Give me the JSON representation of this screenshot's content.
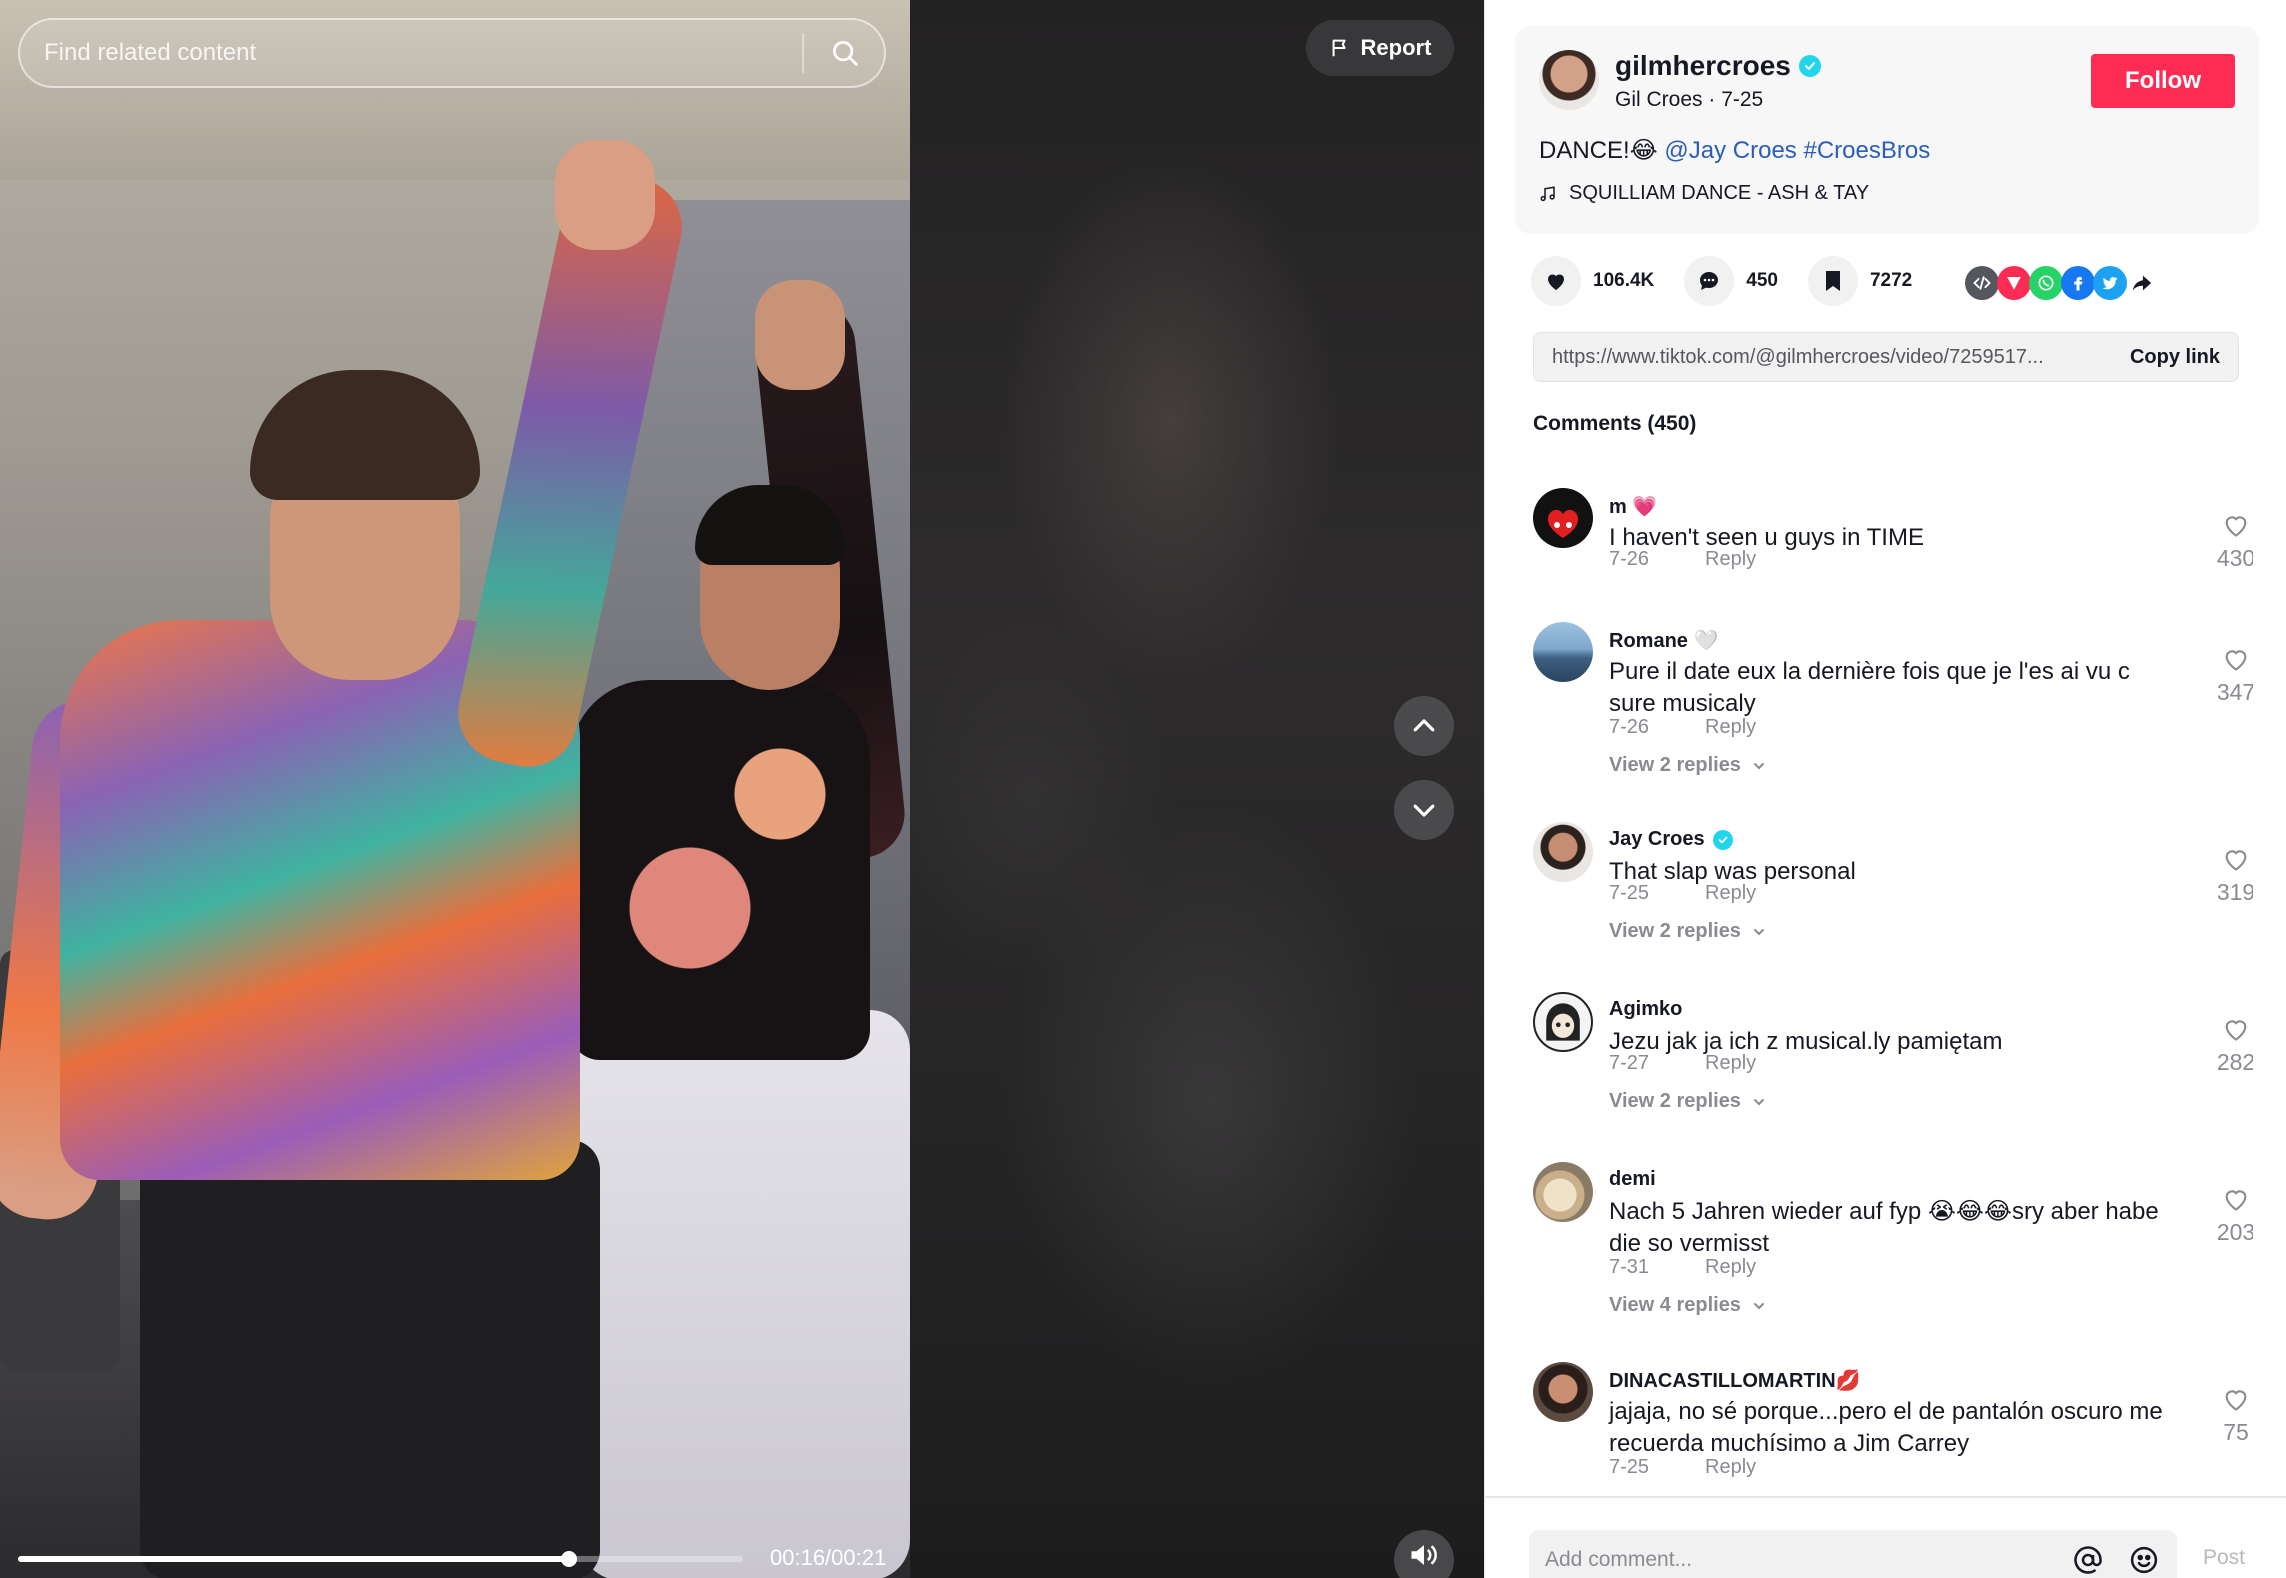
{
  "search": {
    "placeholder": "Find related content"
  },
  "video": {
    "report_label": "Report",
    "time_readout": "00:16/00:21",
    "progress": 0.76
  },
  "author": {
    "username": "gilmhercroes",
    "display_name": "Gil Croes",
    "date": "7-25",
    "follow_label": "Follow",
    "caption_text": "DANCE!😂",
    "caption_mention": "@Jay Croes",
    "caption_hashtag": "#CroesBros",
    "music": "SQUILLIAM DANCE - ASH & TAY",
    "verified": true
  },
  "stats": {
    "likes": "106.4K",
    "comments": "450",
    "saves": "7272"
  },
  "share_icons": [
    "embed-icon",
    "send-icon",
    "whatsapp-icon",
    "facebook-icon",
    "twitter-icon",
    "share-arrow-icon"
  ],
  "link": {
    "url": "https://www.tiktok.com/@gilmhercroes/video/7259517...",
    "copy_label": "Copy link"
  },
  "comments_title": "Comments (450)",
  "reply_label": "Reply",
  "comments": [
    {
      "user": "m 💗",
      "text": "I haven't seen u guys in TIME",
      "date": "7-26",
      "likes": "430",
      "replies": ""
    },
    {
      "user": "Romane 🤍",
      "text": "Pure il date eux la dernière fois que je l'es ai vu c sure musicaly",
      "date": "7-26",
      "likes": "347",
      "replies": "View 2 replies"
    },
    {
      "user": "Jay Croes",
      "text": "That slap was personal",
      "date": "7-25",
      "likes": "319",
      "replies": "View 2 replies",
      "verified": true
    },
    {
      "user": "Agimko",
      "text": "Jezu jak ja ich z musical.ly pamiętam",
      "date": "7-27",
      "likes": "282",
      "replies": "View 2 replies"
    },
    {
      "user": "demi",
      "text": "Nach 5 Jahren wieder auf fyp 😭😂😂sry aber habe die so vermisst",
      "date": "7-31",
      "likes": "203",
      "replies": "View 4 replies"
    },
    {
      "user": "DINACASTILLOMARTIN💋",
      "text": "jajaja, no sé porque...pero el de pantalón oscuro me recuerda muchísimo a Jim Carrey",
      "date": "7-25",
      "likes": "75",
      "replies": ""
    }
  ],
  "comment_input": {
    "placeholder": "Add comment...",
    "post_label": "Post"
  },
  "colors": {
    "accent": "#fe2c55",
    "link": "#2b5db9",
    "verified": "#20d5ec"
  }
}
